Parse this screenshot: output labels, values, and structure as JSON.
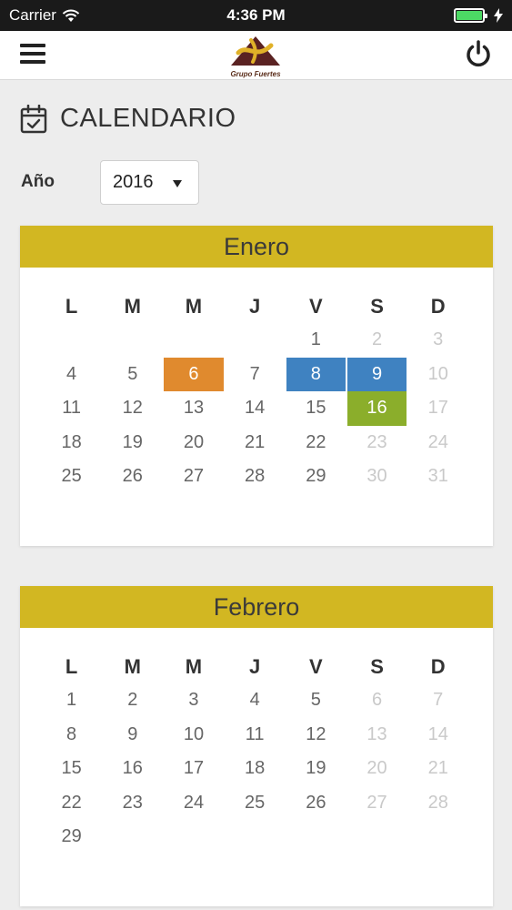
{
  "status": {
    "carrier": "Carrier",
    "time": "4:36 PM"
  },
  "header": {
    "logo_text": "Grupo Fuertes"
  },
  "page": {
    "title": "CALENDARIO",
    "year_label": "Año",
    "year_value": "2016"
  },
  "colors": {
    "header_gold": "#d2b722",
    "orange": "#e08a2e",
    "blue": "#3f82c1",
    "green": "#8bae2b"
  },
  "calendar": {
    "weekdays": [
      "L",
      "M",
      "M",
      "J",
      "V",
      "S",
      "D"
    ],
    "months": [
      {
        "name": "Enero",
        "days": [
          [
            "",
            "",
            "",
            "",
            "1",
            "2",
            "3"
          ],
          [
            "4",
            "5",
            "6",
            "7",
            "8",
            "9",
            "10"
          ],
          [
            "11",
            "12",
            "13",
            "14",
            "15",
            "16",
            "17"
          ],
          [
            "18",
            "19",
            "20",
            "21",
            "22",
            "23",
            "24"
          ],
          [
            "25",
            "26",
            "27",
            "28",
            "29",
            "30",
            "31"
          ]
        ],
        "highlights": {
          "6": "orange",
          "8": "blue",
          "9": "blue",
          "16": "green"
        }
      },
      {
        "name": "Febrero",
        "days": [
          [
            "1",
            "2",
            "3",
            "4",
            "5",
            "6",
            "7"
          ],
          [
            "8",
            "9",
            "10",
            "11",
            "12",
            "13",
            "14"
          ],
          [
            "15",
            "16",
            "17",
            "18",
            "19",
            "20",
            "21"
          ],
          [
            "22",
            "23",
            "24",
            "25",
            "26",
            "27",
            "28"
          ],
          [
            "29",
            "",
            "",
            "",
            "",
            "",
            ""
          ]
        ],
        "highlights": {}
      }
    ]
  }
}
